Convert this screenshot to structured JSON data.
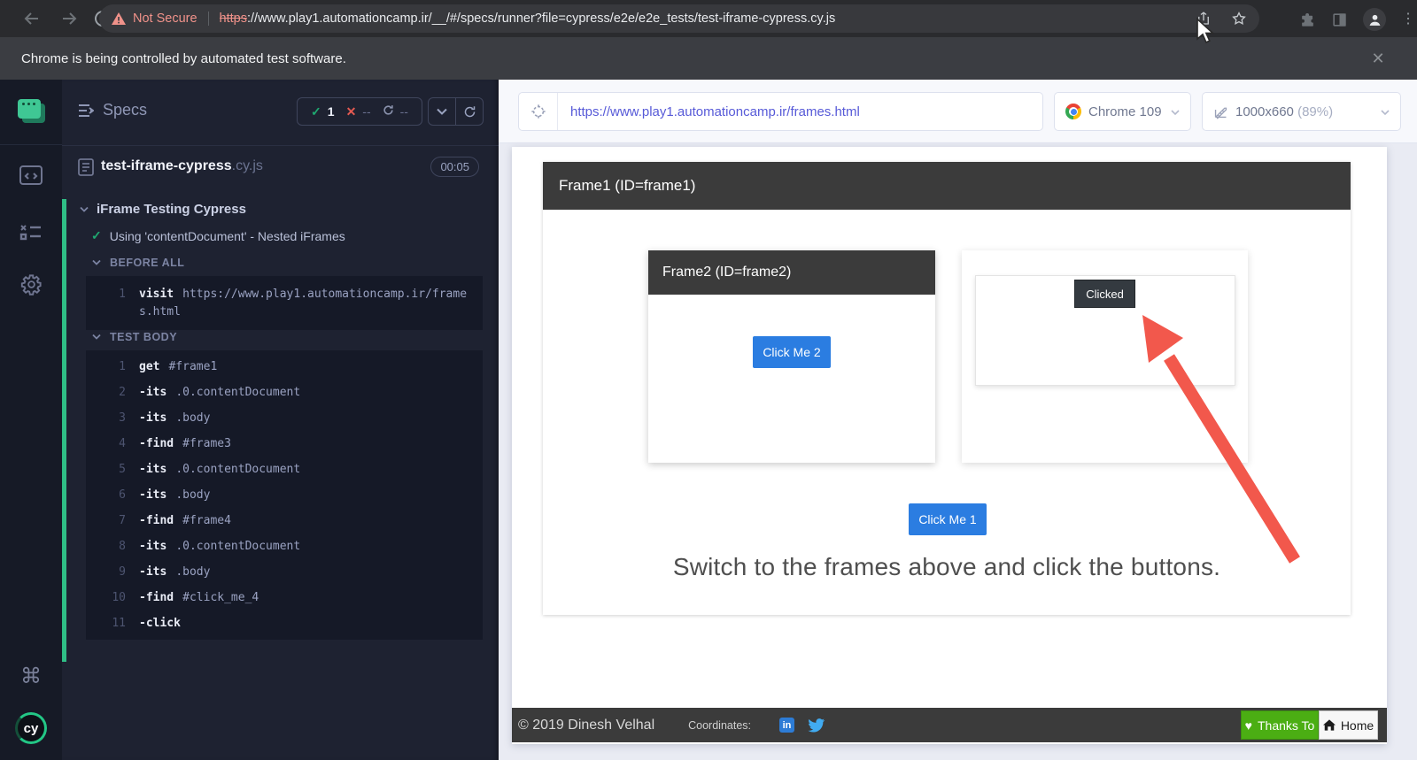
{
  "browser": {
    "security_label": "Not Secure",
    "url_scheme": "https",
    "url_rest": "://www.play1.automationcamp.ir/__/#/specs/runner?file=cypress/e2e/e2e_tests/test-iframe-cypress.cy.js",
    "banner_text": "Chrome is being controlled by automated test software.",
    "close_label": "✕",
    "dots_label": "⋮"
  },
  "specs_panel": {
    "title": "Specs",
    "stats": {
      "passed": "1",
      "failed": "--",
      "pending": "--"
    },
    "spec_file": {
      "name": "test-iframe-cypress",
      "ext": ".cy.js",
      "duration": "00:05"
    },
    "suite": "iFrame Testing Cypress",
    "test": "Using 'contentDocument' - Nested iFrames",
    "test_check": "✓",
    "hooks": [
      {
        "label": "BEFORE ALL",
        "commands": [
          {
            "n": "1",
            "method": "visit",
            "args": "https://www.play1.automationcamp.ir/frames.html"
          }
        ]
      },
      {
        "label": "TEST BODY",
        "commands": [
          {
            "n": "1",
            "method": "get",
            "args": "#frame1"
          },
          {
            "n": "2",
            "method": "-its",
            "args": ".0.contentDocument"
          },
          {
            "n": "3",
            "method": "-its",
            "args": ".body"
          },
          {
            "n": "4",
            "method": "-find",
            "args": "#frame3"
          },
          {
            "n": "5",
            "method": "-its",
            "args": ".0.contentDocument"
          },
          {
            "n": "6",
            "method": "-its",
            "args": ".body"
          },
          {
            "n": "7",
            "method": "-find",
            "args": "#frame4"
          },
          {
            "n": "8",
            "method": "-its",
            "args": ".0.contentDocument"
          },
          {
            "n": "9",
            "method": "-its",
            "args": ".body"
          },
          {
            "n": "10",
            "method": "-find",
            "args": "#click_me_4"
          },
          {
            "n": "11",
            "method": "-click",
            "args": ""
          }
        ]
      }
    ]
  },
  "sidebar": {
    "command_key": "⌘",
    "logo_text": "cy"
  },
  "aut": {
    "url": "https://www.play1.automationcamp.ir/frames.html",
    "browser_version": "Chrome 109",
    "viewport": "1000x660",
    "zoom_pct": "(89%)",
    "frame1_title": "Frame1 (ID=frame1)",
    "frame2_title": "Frame2 (ID=frame2)",
    "click_me_2": "Click Me 2",
    "clicked": "Clicked",
    "click_me_1": "Click Me 1",
    "caption": "Switch to the frames above and click the buttons.",
    "footer": {
      "copyright": "© 2019 Dinesh Velhal",
      "coordinates_label": "Coordinates:",
      "linkedin": "in",
      "thanks_to": "Thanks To",
      "home": "Home",
      "heart": "♥"
    }
  },
  "colors": {
    "accent_green": "#1fa971",
    "pass_bar": "#2fbf86",
    "fail_red": "#e45a52",
    "button_blue": "#2b7de1",
    "thanks_green": "#4bae13",
    "annotation_red": "#f2584c",
    "url_indigo": "#575ad8",
    "warning_salmon": "#f0928a"
  }
}
